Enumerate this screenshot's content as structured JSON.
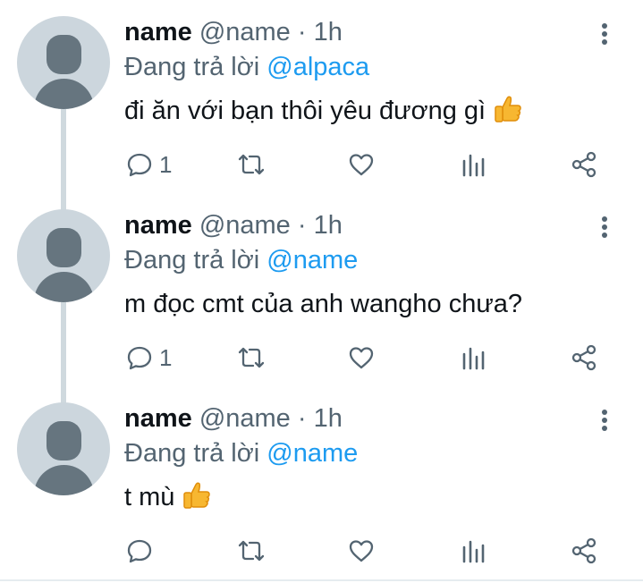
{
  "tweets": [
    {
      "name": "name",
      "handle": "@name",
      "separator": "·",
      "time": "1h",
      "reply_prefix": "Đang trả lời ",
      "reply_to": "@alpaca",
      "text": "đi ăn với bạn thôi yêu đương gì",
      "emoji": "thumbs-up-icon",
      "reply_count": "1"
    },
    {
      "name": "name",
      "handle": "@name",
      "separator": "·",
      "time": "1h",
      "reply_prefix": "Đang trả lời ",
      "reply_to": "@name",
      "text": "m đọc cmt của anh wangho chưa?",
      "emoji": "",
      "reply_count": "1"
    },
    {
      "name": "name",
      "handle": "@name",
      "separator": "·",
      "time": "1h",
      "reply_prefix": "Đang trả lời ",
      "reply_to": "@name",
      "text": "t mù",
      "emoji": "thumbs-up-icon",
      "reply_count": ""
    }
  ],
  "colors": {
    "accent": "#1d9bf0",
    "secondary_text": "#536471",
    "avatar_bg": "#ccd6dd",
    "avatar_fg": "#66757f",
    "thread_line": "#cfd9de"
  }
}
